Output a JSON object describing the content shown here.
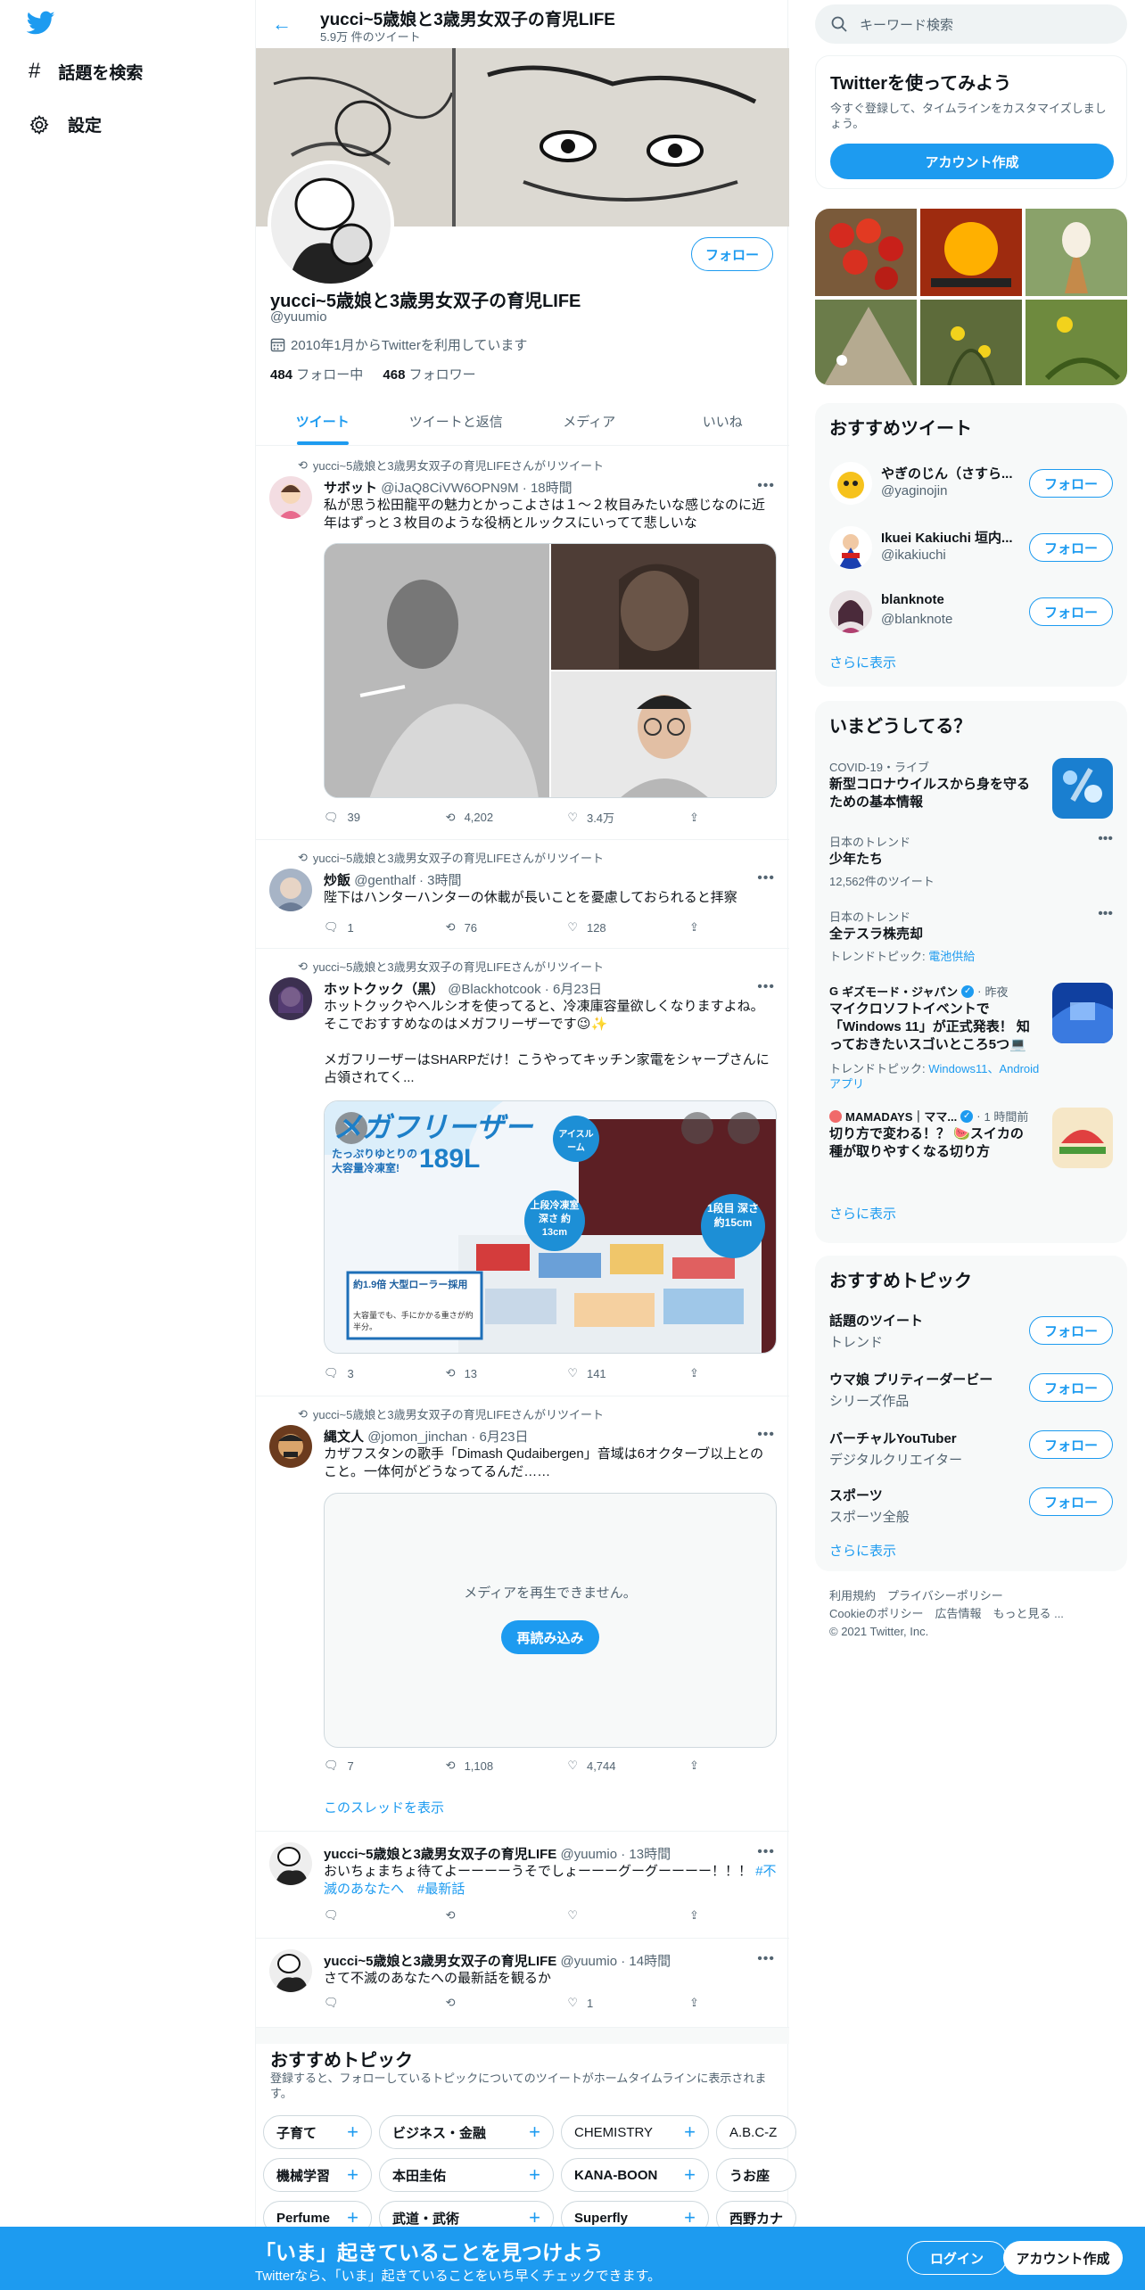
{
  "nav": {
    "explore": "話題を検索",
    "settings": "設定"
  },
  "header": {
    "title": "yucci~5歳娘と3歳男女双子の育児LIFE",
    "subtitle": "5.9万 件のツイート"
  },
  "profile": {
    "name": "yucci~5歳娘と3歳男女双子の育児LIFE",
    "handle": "@yuumio",
    "joined": "2010年1月からTwitterを利用しています",
    "following_count": "484",
    "following_label": "フォロー中",
    "followers_count": "468",
    "followers_label": "フォロワー",
    "follow_label": "フォロー"
  },
  "tabs": [
    "ツイート",
    "ツイートと返信",
    "メディア",
    "いいね"
  ],
  "tweets": [
    {
      "rt": "yucci~5歳娘と3歳男女双子の育児LIFEさんがリツイート",
      "name": "サボット",
      "handle": "@iJaQ8CiVW6OPN9M",
      "time": "18時間",
      "text": "私が思う松田龍平の魅力とかっこよさは１〜２枚目みたいな感じなのに近年はずっと３枚目のような役柄とルックスにいってて悲しいな",
      "reply": "39",
      "retweet": "4,202",
      "like": "3.4万"
    },
    {
      "rt": "yucci~5歳娘と3歳男女双子の育児LIFEさんがリツイート",
      "name": "炒飯",
      "handle": "@genthalf",
      "time": "3時間",
      "text": "陛下はハンターハンターの休載が長いことを憂慮しておられると拝察",
      "reply": "1",
      "retweet": "76",
      "like": "128"
    },
    {
      "rt": "yucci~5歳娘と3歳男女双子の育児LIFEさんがリツイート",
      "name": "ホットクック（黒）",
      "handle": "@Blackhotcook",
      "time": "6月23日",
      "text1": "ホットクックやヘルシオを使ってると、冷凍庫容量欲しくなりますよね。そこでおすすめなのはメガフリーザーです😉✨",
      "text2": "メガフリーザーはSHARPだけ！こうやってキッチン家電をシャープさんに占領されてく...",
      "reply": "3",
      "retweet": "13",
      "like": "141",
      "ad": {
        "title": "メガフリーザー",
        "sub1": "たっぷりゆとりの",
        "sub2": "大容量冷凍室!",
        "cap": "189L",
        "icebadge": "アイスルーム",
        "upper": "上段冷凍室 深さ 約13cm",
        "first": "1段目 深さ 約15cm",
        "roller": "約1.9倍 大型ローラー採用",
        "roller_note": "大容量でも、手にかかる重さが約半分。"
      }
    },
    {
      "rt": "yucci~5歳娘と3歳男女双子の育児LIFEさんがリツイート",
      "name": "縄文人",
      "handle": "@jomon_jinchan",
      "time": "6月23日",
      "text": "カザフスタンの歌手「Dimash Qudaibergen」音域は6オクターブ以上とのこと。一体何がどうなってるんだ……",
      "media_error": "メディアを再生できません。",
      "reload": "再読み込み",
      "reply": "7",
      "retweet": "1,108",
      "like": "4,744",
      "thread": "このスレッドを表示"
    },
    {
      "name": "yucci~5歳娘と3歳男女双子の育児LIFE",
      "handle": "@yuumio",
      "time": "13時間",
      "text": "おいちょまちょ待てよーーーーうそでしょーーーグーグーーーー！！！",
      "tag1": "#不滅のあなたへ",
      "tag2": "#最新話"
    },
    {
      "name": "yucci~5歳娘と3歳男女双子の育児LIFE",
      "handle": "@yuumio",
      "time": "14時間",
      "text": "さて不滅のあなたへの最新話を観るか",
      "like": "1"
    }
  ],
  "topics_bottom": {
    "title": "おすすめトピック",
    "desc": "登録すると、フォローしているトピックについてのツイートがホームタイムラインに表示されます。",
    "row1": [
      "子育て",
      "ビジネス・金融",
      "CHEMISTRY",
      "A.B.C-Z"
    ],
    "row2": [
      "機械学習",
      "本田圭佑",
      "KANA-BOON",
      "うお座"
    ],
    "row3": [
      "Perfume",
      "武道・武術",
      "Superfly",
      "西野カナ"
    ]
  },
  "right": {
    "search_placeholder": "キーワード検索",
    "signup": {
      "title": "Twitterを使ってみよう",
      "desc": "今すぐ登録して、タイムラインをカスタマイズしましょう。",
      "button": "アカウント作成"
    },
    "who": {
      "title": "おすすめツイート",
      "users": [
        {
          "name": "やぎのじん（さすら...",
          "handle": "@yaginojin"
        },
        {
          "name": "Ikuei Kakiuchi 垣内...",
          "handle": "@ikakiuchi"
        },
        {
          "name": "blanknote",
          "handle": "@blanknote"
        }
      ],
      "follow": "フォロー",
      "more": "さらに表示"
    },
    "trends": {
      "title": "いまどうしてる？",
      "items": [
        {
          "meta": "COVID-19・ライブ",
          "title": "新型コロナウイルスから身を守るための基本情報"
        },
        {
          "meta": "日本のトレンド",
          "title": "少年たち",
          "sub": "12,562件のツイート"
        },
        {
          "meta": "日本のトレンド",
          "title": "全テスラ株売却",
          "sub": "トレンドトピック: ",
          "link": "電池供給"
        },
        {
          "meta": "ギズモード・ジャパン",
          "meta2": "昨夜",
          "title": "マイクロソフトイベントで「Windows 11」が正式発表！ 知っておきたいスゴいところ5つ💻",
          "sub": "トレンドトピック: ",
          "link": "Windows11、Android アプリ"
        },
        {
          "meta": "MAMADAYS｜ママ...",
          "meta2": "1 時間前",
          "title": "切り方で変わる！？ 🍉スイカの種が取りやすくなる切り方"
        }
      ],
      "more": "さらに表示"
    },
    "topics": {
      "title": "おすすめトピック",
      "items": [
        {
          "name": "話題のツイート",
          "cat": "トレンド"
        },
        {
          "name": "ウマ娘 プリティーダービー",
          "cat": "シリーズ作品"
        },
        {
          "name": "バーチャルYouTuber",
          "cat": "デジタルクリエイター"
        },
        {
          "name": "スポーツ",
          "cat": "スポーツ全般"
        }
      ],
      "follow": "フォロー",
      "more": "さらに表示"
    },
    "footer": {
      "line1": "利用規約　プライバシーポリシー",
      "line2": "Cookieのポリシー　広告情報　もっと見る ...",
      "line3": "© 2021 Twitter, Inc."
    }
  },
  "bottombar": {
    "title": "「いま」起きていることを見つけよう",
    "subtitle": "Twitterなら、「いま」起きていることをいち早くチェックできます。",
    "login": "ログイン",
    "signup": "アカウント作成"
  },
  "colors": {
    "accent": "#1d9bf0",
    "text": "#0f1419",
    "muted": "#536471"
  }
}
